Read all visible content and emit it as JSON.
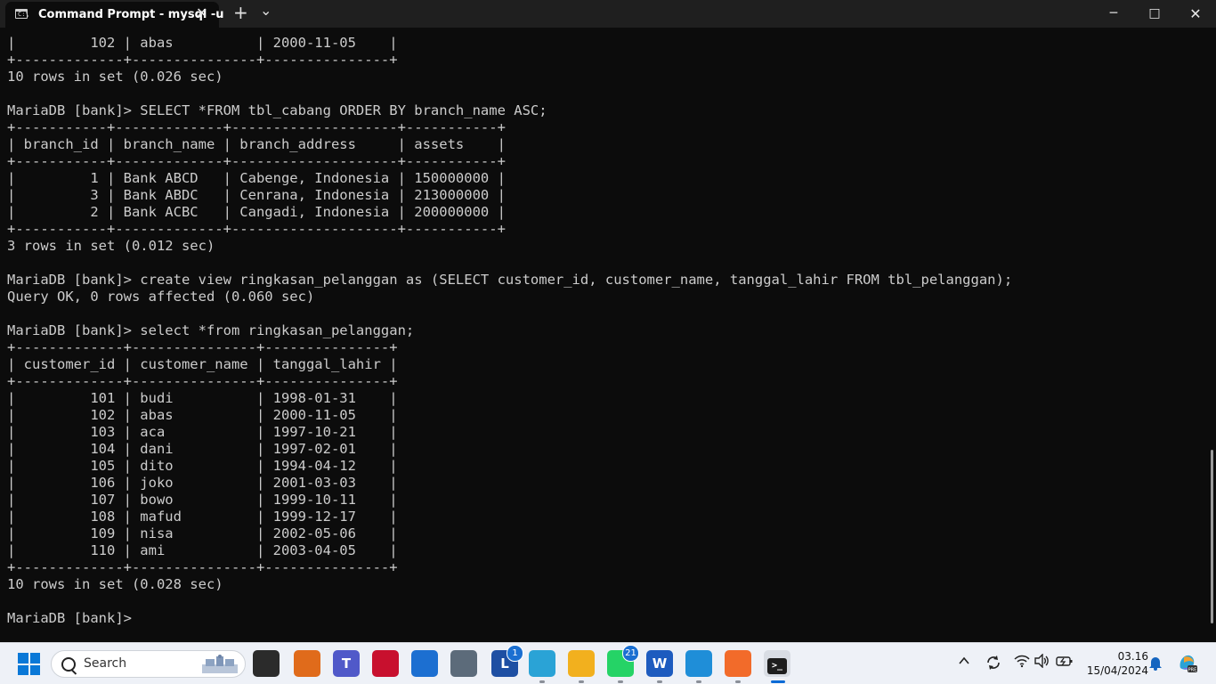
{
  "window": {
    "tab_title": "Command Prompt - mysql  -u",
    "tab_icon_text": "C:\\",
    "controls": {
      "minimize": "─",
      "maximize": "□",
      "close": "✕"
    },
    "new_tab": "+",
    "dropdown": "⌄",
    "tab_close": "✕"
  },
  "terminal": {
    "lines": [
      "|         102 | abas          | 2000-11-05    |",
      "+-------------+---------------+---------------+",
      "10 rows in set (0.026 sec)",
      "",
      "MariaDB [bank]> SELECT *FROM tbl_cabang ORDER BY branch_name ASC;",
      "+-----------+-------------+--------------------+-----------+",
      "| branch_id | branch_name | branch_address     | assets    |",
      "+-----------+-------------+--------------------+-----------+",
      "|         1 | Bank ABCD   | Cabenge, Indonesia | 150000000 |",
      "|         3 | Bank ABDC   | Cenrana, Indonesia | 213000000 |",
      "|         2 | Bank ACBC   | Cangadi, Indonesia | 200000000 |",
      "+-----------+-------------+--------------------+-----------+",
      "3 rows in set (0.012 sec)",
      "",
      "MariaDB [bank]> create view ringkasan_pelanggan as (SELECT customer_id, customer_name, tanggal_lahir FROM tbl_pelanggan);",
      "Query OK, 0 rows affected (0.060 sec)",
      "",
      "MariaDB [bank]> select *from ringkasan_pelanggan;",
      "+-------------+---------------+---------------+",
      "| customer_id | customer_name | tanggal_lahir |",
      "+-------------+---------------+---------------+",
      "|         101 | budi          | 1998-01-31    |",
      "|         102 | abas          | 2000-11-05    |",
      "|         103 | aca           | 1997-10-21    |",
      "|         104 | dani          | 1997-02-01    |",
      "|         105 | dito          | 1994-04-12    |",
      "|         106 | joko          | 2001-03-03    |",
      "|         107 | bowo          | 1999-10-11    |",
      "|         108 | mafud         | 1999-12-17    |",
      "|         109 | nisa          | 2002-05-06    |",
      "|         110 | ami           | 2003-04-05    |",
      "+-------------+---------------+---------------+",
      "10 rows in set (0.028 sec)",
      "",
      "MariaDB [bank]> "
    ]
  },
  "taskbar": {
    "search_placeholder": "Search",
    "apps": [
      {
        "name": "task-view",
        "glyph": "",
        "color": "#2b2b2b"
      },
      {
        "name": "matlab",
        "glyph": "",
        "color": "#e06b1b"
      },
      {
        "name": "teams",
        "glyph": "T",
        "color": "#5059c9"
      },
      {
        "name": "mcafee",
        "glyph": "",
        "color": "#c8102e"
      },
      {
        "name": "store",
        "glyph": "",
        "color": "#1c6fd1"
      },
      {
        "name": "camera",
        "glyph": "",
        "color": "#5c6b7a"
      },
      {
        "name": "launcher",
        "glyph": "L",
        "color": "#1e4fa3",
        "badge": "1"
      },
      {
        "name": "edge",
        "glyph": "",
        "color": "#2aa3d6"
      },
      {
        "name": "file-explorer",
        "glyph": "",
        "color": "#f2b01e"
      },
      {
        "name": "whatsapp",
        "glyph": "",
        "color": "#25d366",
        "badge": "21"
      },
      {
        "name": "word",
        "glyph": "W",
        "color": "#1d5bbf"
      },
      {
        "name": "paint",
        "glyph": "",
        "color": "#1f8ed8"
      },
      {
        "name": "xampp",
        "glyph": "",
        "color": "#f26b2a"
      },
      {
        "name": "terminal",
        "glyph": "",
        "color": "#2d2d2d",
        "active": true
      }
    ],
    "tray": {
      "chevron": "^",
      "time": "03.16",
      "date": "15/04/2024"
    }
  }
}
